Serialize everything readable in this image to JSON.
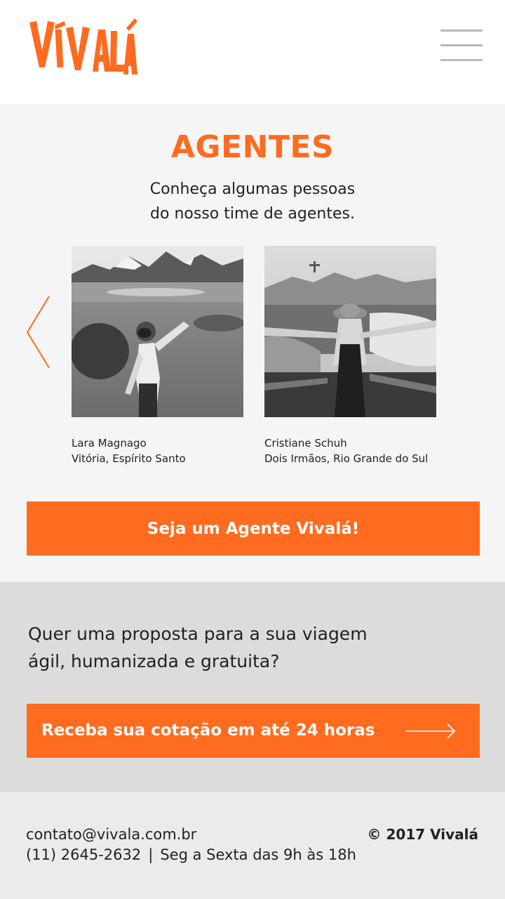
{
  "brand": {
    "name": "Vivalá",
    "logo_text": "VIVALÁ",
    "accent_color": "#ff6b1f"
  },
  "header": {
    "menu_icon": "hamburger-menu-icon"
  },
  "agents": {
    "title": "AGENTES",
    "subtitle_line1": "Conheça algumas pessoas",
    "subtitle_line2": "do nosso time de agentes.",
    "prev_icon": "chevron-left-icon",
    "cards": [
      {
        "name": "Lara Magnago",
        "location": "Vitória, Espírito Santo"
      },
      {
        "name": "Cristiane Schuh",
        "location": "Dois Irmãos, Rio Grande do Sul"
      }
    ],
    "cta_label": "Seja um Agente Vivalá!"
  },
  "quote": {
    "text_line1": "Quer uma proposta para a sua viagem",
    "text_line2": "ágil, humanizada e gratuita?",
    "cta_label": "Receba sua cotação em até 24 horas",
    "cta_icon": "arrow-right-icon"
  },
  "footer": {
    "email": "contato@vivala.com.br",
    "phone": "(11) 2645-2632",
    "separator": "|",
    "hours": "Seg a Sexta das 9h às 18h",
    "copyright": "© 2017 Vivalá"
  }
}
